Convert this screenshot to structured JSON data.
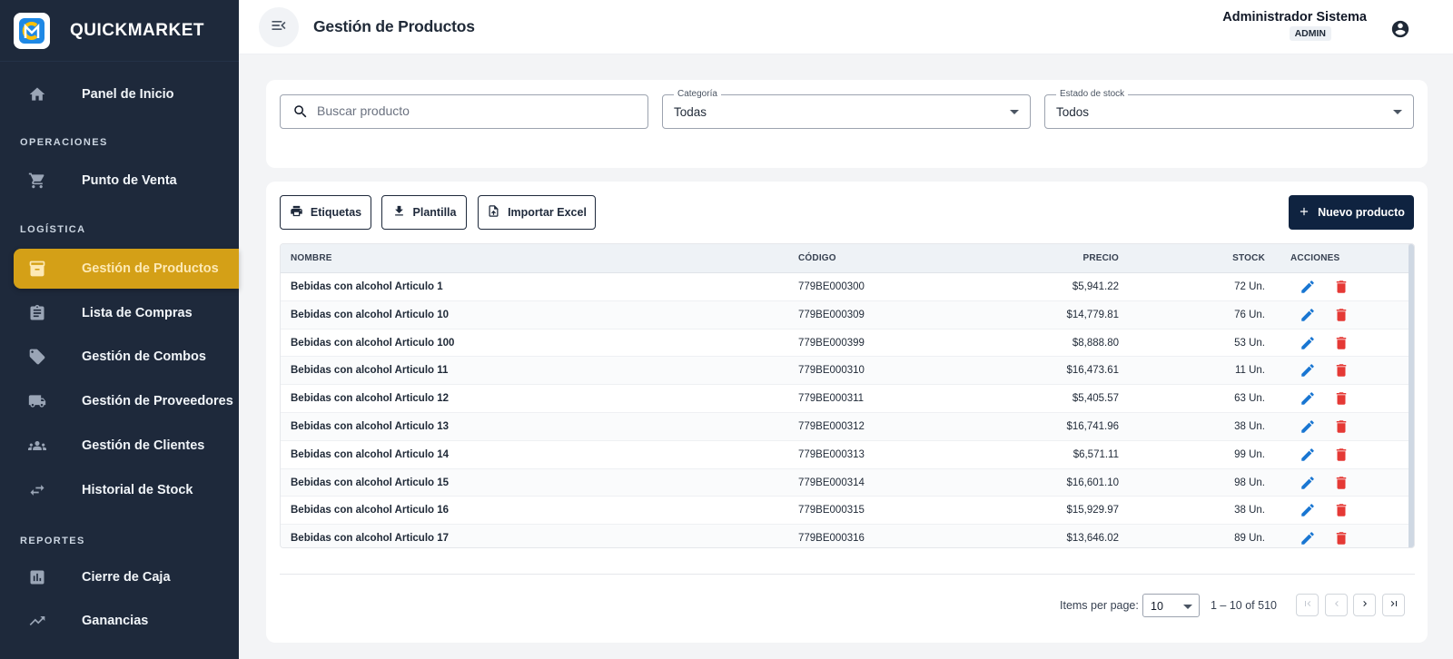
{
  "brand": {
    "name": "QUICKMARKET"
  },
  "sidebar": {
    "items": [
      {
        "label": "Panel de Inicio",
        "icon": "home-icon"
      },
      {
        "label": "Punto de Venta",
        "icon": "cart-icon"
      },
      {
        "label": "Gestión de Productos",
        "icon": "archive-icon",
        "active": true
      },
      {
        "label": "Lista de Compras",
        "icon": "clipboard-icon"
      },
      {
        "label": "Gestión de Combos",
        "icon": "tag-icon"
      },
      {
        "label": "Gestión de Proveedores",
        "icon": "truck-icon"
      },
      {
        "label": "Gestión de Clientes",
        "icon": "group-icon"
      },
      {
        "label": "Historial de Stock",
        "icon": "swap-icon"
      },
      {
        "label": "Cierre de Caja",
        "icon": "bar-chart-icon"
      },
      {
        "label": "Ganancias",
        "icon": "trending-up-icon"
      }
    ],
    "sections": [
      "OPERACIONES",
      "LOGÍSTICA",
      "REPORTES"
    ]
  },
  "header": {
    "title": "Gestión de Productos",
    "user_name": "Administrador Sistema",
    "user_role": "ADMIN"
  },
  "filters": {
    "search_placeholder": "Buscar producto",
    "category_label": "Categoría",
    "category_value": "Todas",
    "stock_label": "Estado de stock",
    "stock_value": "Todos"
  },
  "toolbar": {
    "labels_button": "Etiquetas",
    "template_button": "Plantilla",
    "import_button": "Importar Excel",
    "new_button": "Nuevo producto"
  },
  "table": {
    "headers": {
      "name": "NOMBRE",
      "code": "CÓDIGO",
      "price": "PRECIO",
      "stock": "STOCK",
      "actions": "ACCIONES"
    },
    "rows": [
      {
        "name": "Bebidas con alcohol Articulo 1",
        "code": "779BE000300",
        "price": "$5,941.22",
        "stock": "72 Un."
      },
      {
        "name": "Bebidas con alcohol Articulo 10",
        "code": "779BE000309",
        "price": "$14,779.81",
        "stock": "76 Un."
      },
      {
        "name": "Bebidas con alcohol Articulo 100",
        "code": "779BE000399",
        "price": "$8,888.80",
        "stock": "53 Un."
      },
      {
        "name": "Bebidas con alcohol Articulo 11",
        "code": "779BE000310",
        "price": "$16,473.61",
        "stock": "11 Un."
      },
      {
        "name": "Bebidas con alcohol Articulo 12",
        "code": "779BE000311",
        "price": "$5,405.57",
        "stock": "63 Un."
      },
      {
        "name": "Bebidas con alcohol Articulo 13",
        "code": "779BE000312",
        "price": "$16,741.96",
        "stock": "38 Un."
      },
      {
        "name": "Bebidas con alcohol Articulo 14",
        "code": "779BE000313",
        "price": "$6,571.11",
        "stock": "99 Un."
      },
      {
        "name": "Bebidas con alcohol Articulo 15",
        "code": "779BE000314",
        "price": "$16,601.10",
        "stock": "98 Un."
      },
      {
        "name": "Bebidas con alcohol Articulo 16",
        "code": "779BE000315",
        "price": "$15,929.97",
        "stock": "38 Un."
      },
      {
        "name": "Bebidas con alcohol Articulo 17",
        "code": "779BE000316",
        "price": "$13,646.02",
        "stock": "89 Un."
      }
    ]
  },
  "pagination": {
    "items_per_page_label": "Items per page:",
    "items_per_page_value": "10",
    "range_label": "1 – 10 of 510"
  },
  "colors": {
    "sidebar_bg": "#1e293b",
    "active_item": "#d4a017",
    "primary_button": "#0f2340",
    "edit_icon": "#1976d2",
    "delete_icon": "#e53935"
  }
}
